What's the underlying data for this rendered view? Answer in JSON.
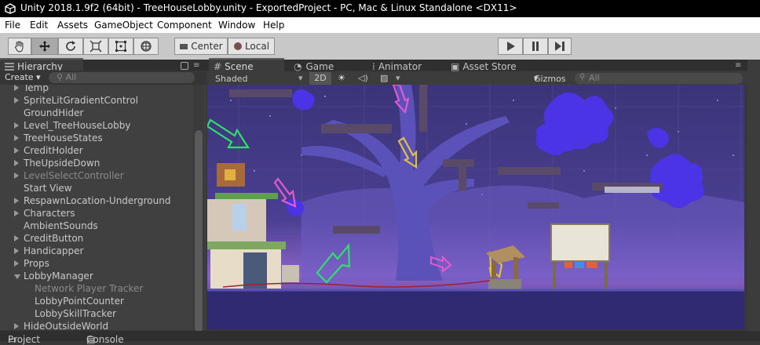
{
  "window": {
    "title": "Unity 2018.1.9f2 (64bit) - TreeHouseLobby.unity - ExportedProject - PC, Mac & Linux Standalone <DX11>"
  },
  "menu": [
    "File",
    "Edit",
    "Assets",
    "GameObject",
    "Component",
    "Window",
    "Help"
  ],
  "toolbar": {
    "tools": [
      "hand-tool",
      "move-tool",
      "rotate-tool",
      "scale-tool",
      "rect-tool",
      "transform-tool"
    ],
    "pivot_label": "Center",
    "space_label": "Local",
    "play_icons": [
      "play-icon",
      "pause-icon",
      "step-icon"
    ]
  },
  "hierarchy": {
    "tab_label": "Hierarchy",
    "create_label": "Create",
    "search_placeholder": "All",
    "items": [
      {
        "label": "Temp",
        "arrow": "right",
        "dim": false,
        "indent": 0
      },
      {
        "label": "SpriteLitGradientControl",
        "arrow": "right",
        "dim": false,
        "indent": 0
      },
      {
        "label": "GroundHider",
        "arrow": "",
        "dim": false,
        "indent": 0
      },
      {
        "label": "Level_TreeHouseLobby",
        "arrow": "right",
        "dim": false,
        "indent": 0
      },
      {
        "label": "TreeHouseStates",
        "arrow": "right",
        "dim": false,
        "indent": 0
      },
      {
        "label": "CreditHolder",
        "arrow": "right",
        "dim": false,
        "indent": 0
      },
      {
        "label": "TheUpsideDown",
        "arrow": "right",
        "dim": false,
        "indent": 0
      },
      {
        "label": "LevelSelectController",
        "arrow": "right",
        "dim": true,
        "indent": 0
      },
      {
        "label": "Start View",
        "arrow": "",
        "dim": false,
        "indent": 0
      },
      {
        "label": "RespawnLocation-Underground",
        "arrow": "right",
        "dim": false,
        "indent": 0
      },
      {
        "label": "Characters",
        "arrow": "right",
        "dim": false,
        "indent": 0
      },
      {
        "label": "AmbientSounds",
        "arrow": "",
        "dim": false,
        "indent": 0
      },
      {
        "label": "CreditButton",
        "arrow": "right",
        "dim": false,
        "indent": 0
      },
      {
        "label": "Handicapper",
        "arrow": "right",
        "dim": false,
        "indent": 0
      },
      {
        "label": "Props",
        "arrow": "right",
        "dim": false,
        "indent": 0
      },
      {
        "label": "LobbyManager",
        "arrow": "down",
        "dim": false,
        "indent": 0
      },
      {
        "label": "Network Player Tracker",
        "arrow": "",
        "dim": true,
        "indent": 1
      },
      {
        "label": "LobbyPointCounter",
        "arrow": "",
        "dim": false,
        "indent": 1
      },
      {
        "label": "LobbySkillTracker",
        "arrow": "",
        "dim": false,
        "indent": 1
      },
      {
        "label": "HideOutsideWorld",
        "arrow": "right",
        "dim": false,
        "indent": 0
      }
    ]
  },
  "tabs": {
    "scene": "Scene",
    "game": "Game",
    "animator": "Animator",
    "asset_store": "Asset Store"
  },
  "scene_toolbar": {
    "shading": "Shaded",
    "mode_2d": "2D",
    "gizmos": "Gizmos",
    "search_placeholder": "All"
  },
  "bottom_tabs": [
    "Project",
    "Console"
  ],
  "colors": {
    "sky": "#47408f",
    "tree": "#5a52b8",
    "foliage": "#4a34e6",
    "ground": "#2f2a72",
    "arrow_green": "#2fe06a",
    "arrow_pink": "#e05ad0",
    "arrow_yellow": "#e0c040"
  }
}
